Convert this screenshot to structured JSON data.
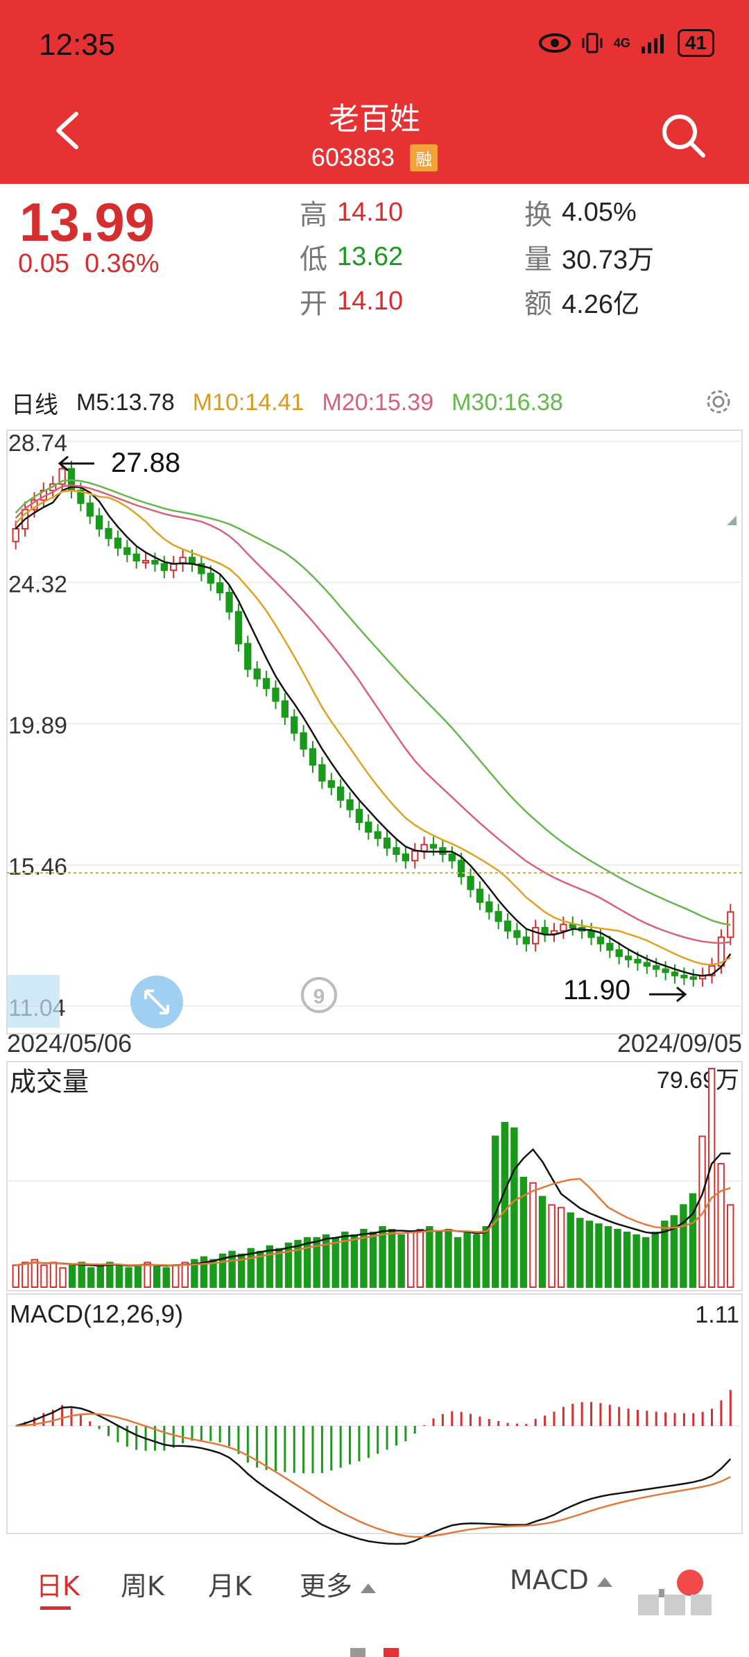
{
  "status": {
    "time": "12:35",
    "network": "4G",
    "battery": "41"
  },
  "header": {
    "name": "老百姓",
    "code": "603883",
    "badge": "融"
  },
  "quote": {
    "last": "13.99",
    "change": "0.05",
    "change_pct": "0.36%",
    "high_label": "高",
    "high": "14.10",
    "low_label": "低",
    "low": "13.62",
    "open_label": "开",
    "open": "14.10",
    "turnover_label": "换",
    "turnover": "4.05%",
    "volume_label": "量",
    "volume": "30.73万",
    "amount_label": "额",
    "amount": "4.26亿"
  },
  "ma_bar": {
    "period": "日线",
    "m5": "M5:13.78",
    "m10": "M10:14.41",
    "m20": "M20:15.39",
    "m30": "M30:16.38"
  },
  "colors": {
    "up": "#d62e2e",
    "down": "#1a9a1a",
    "ma5": "#111111",
    "ma10": "#e0a020",
    "ma20": "#d9607a",
    "ma30": "#62b84a",
    "macd_dea": "#e07a3a"
  },
  "chart_data": [
    {
      "type": "candlestick",
      "title": "",
      "x_start": "2024/05/06",
      "x_end": "2024/09/05",
      "y_ticks": [
        "28.74",
        "24.32",
        "19.89",
        "15.46",
        "11.04"
      ],
      "ylim": [
        11.04,
        28.74
      ],
      "annotations": {
        "high": "27.88",
        "low": "11.90"
      },
      "close_approx": [
        26.0,
        26.6,
        26.9,
        27.2,
        27.4,
        27.88,
        27.2,
        26.8,
        26.4,
        26.0,
        25.7,
        25.4,
        25.2,
        25.0,
        25.0,
        24.9,
        24.7,
        24.9,
        25.1,
        24.9,
        24.6,
        24.3,
        24.0,
        23.4,
        22.4,
        21.6,
        21.3,
        21.0,
        20.6,
        20.1,
        19.6,
        19.1,
        18.6,
        18.1,
        17.9,
        17.5,
        17.2,
        16.8,
        16.5,
        16.3,
        16.0,
        15.8,
        15.6,
        15.9,
        16.1,
        16.0,
        15.8,
        15.6,
        15.1,
        14.7,
        14.3,
        14.0,
        13.7,
        13.4,
        13.2,
        13.0,
        13.5,
        13.3,
        13.4,
        13.6,
        13.5,
        13.4,
        13.2,
        13.0,
        12.8,
        12.6,
        12.5,
        12.4,
        12.3,
        12.2,
        12.1,
        12.0,
        11.95,
        11.9,
        12.0,
        12.3,
        13.2,
        13.99
      ]
    },
    {
      "type": "bar",
      "title": "成交量",
      "max_label": "79.69万",
      "values_approx": [
        8,
        9,
        10,
        8,
        9,
        7,
        8,
        9,
        7,
        8,
        9,
        8,
        7,
        8,
        9,
        8,
        7,
        8,
        9,
        10,
        11,
        10,
        12,
        13,
        12,
        14,
        13,
        15,
        14,
        16,
        17,
        18,
        18,
        19,
        18,
        20,
        19,
        21,
        20,
        22,
        21,
        19,
        20,
        21,
        22,
        20,
        21,
        18,
        20,
        19,
        22,
        55,
        60,
        58,
        40,
        38,
        33,
        30,
        29,
        27,
        25,
        24,
        23,
        22,
        21,
        20,
        19,
        18,
        20,
        24,
        26,
        30,
        34,
        55,
        79.69,
        45,
        30
      ]
    },
    {
      "type": "bar",
      "title": "MACD(12,26,9)",
      "max_label": "1.11"
    }
  ],
  "bottom_nav": {
    "tabs": [
      "日K",
      "周K",
      "月K",
      "更多"
    ],
    "indicator": "MACD"
  }
}
